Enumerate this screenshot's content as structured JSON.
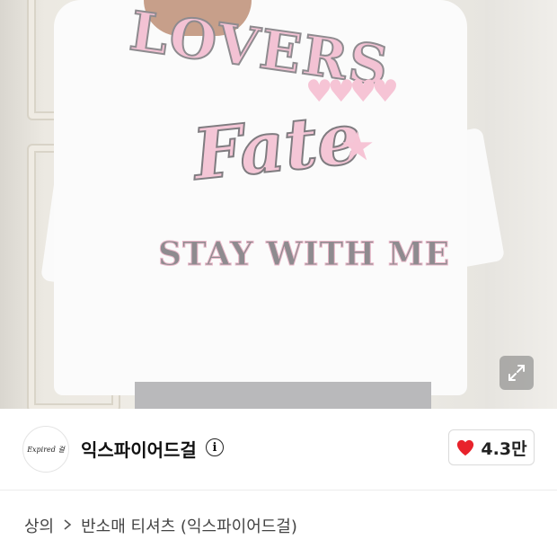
{
  "product_image": {
    "print_text_1": "LOVERS",
    "print_text_2": "Fate",
    "print_text_3": "STAY WITH ME",
    "expand_icon": "expand-arrows-icon"
  },
  "store": {
    "logo_text": "Expired 걸",
    "name": "익스파이어드걸",
    "info_icon": "info-icon"
  },
  "like": {
    "icon": "heart-icon",
    "color": "#e8222b",
    "count": "4.3만"
  },
  "breadcrumb": {
    "category": "상의",
    "separator_icon": "chevron-right-icon",
    "subcategory": "반소매 티셔츠 (익스파이어드걸)"
  }
}
